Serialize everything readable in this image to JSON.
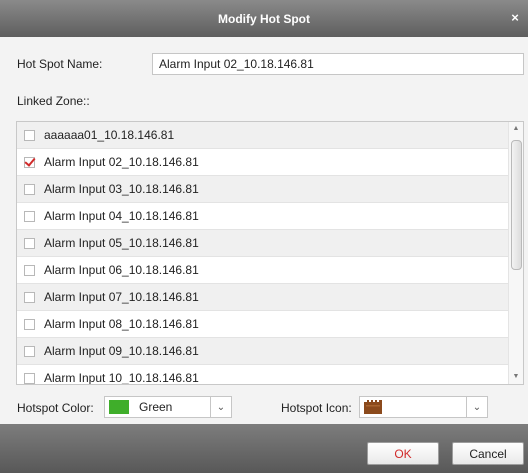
{
  "dialog": {
    "title": "Modify Hot Spot",
    "close_glyph": "×"
  },
  "form": {
    "name_label": "Hot Spot Name:",
    "name_value": "Alarm Input 02_10.18.146.81",
    "linked_zone_label": "Linked Zone::"
  },
  "zones": [
    {
      "label": "aaaaaa01_10.18.146.81",
      "checked": false
    },
    {
      "label": "Alarm Input 02_10.18.146.81",
      "checked": true
    },
    {
      "label": "Alarm Input 03_10.18.146.81",
      "checked": false
    },
    {
      "label": "Alarm Input 04_10.18.146.81",
      "checked": false
    },
    {
      "label": "Alarm Input 05_10.18.146.81",
      "checked": false
    },
    {
      "label": "Alarm Input 06_10.18.146.81",
      "checked": false
    },
    {
      "label": "Alarm Input 07_10.18.146.81",
      "checked": false
    },
    {
      "label": "Alarm Input 08_10.18.146.81",
      "checked": false
    },
    {
      "label": "Alarm Input 09_10.18.146.81",
      "checked": false
    },
    {
      "label": "Alarm Input 10_10.18.146.81",
      "checked": false
    }
  ],
  "hotspot_color": {
    "label": "Hotspot Color:",
    "value": "Green",
    "swatch": "#3fae2a"
  },
  "hotspot_icon": {
    "label": "Hotspot Icon:",
    "icon": "brown-castle-icon",
    "icon_color": "#8b4a1c"
  },
  "buttons": {
    "ok": "OK",
    "cancel": "Cancel",
    "ok_text_color": "#d12b2b"
  }
}
